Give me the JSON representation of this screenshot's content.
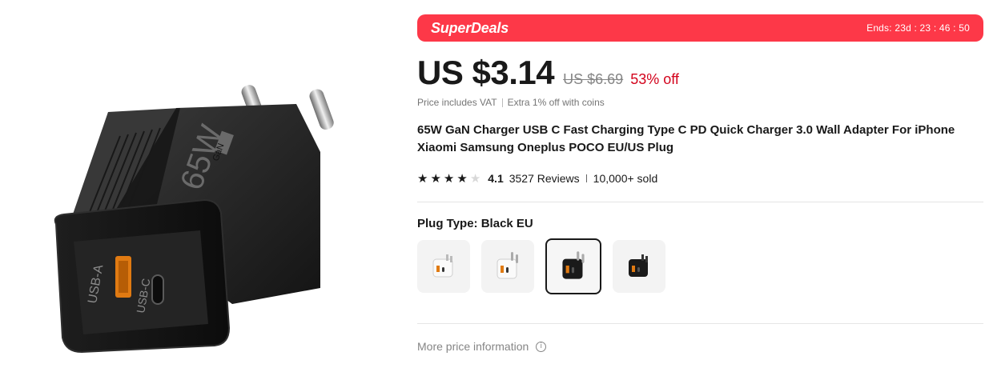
{
  "gallery": {
    "main_image_icon": "charger-product-image",
    "charger_text": {
      "wattage": "65W",
      "gan": "GaN",
      "port_a": "USB-A",
      "port_c": "USB-C"
    }
  },
  "deal": {
    "brand": "SuperDeals",
    "timer": "Ends: 23d : 23 : 46 : 50",
    "color": "#fd3848"
  },
  "price": {
    "current": "US $3.14",
    "original": "US $6.69",
    "discount": "53% off",
    "note_vat": "Price includes VAT",
    "note_coins": "Extra 1% off with coins"
  },
  "product": {
    "title": "65W GaN Charger USB C Fast Charging Type C PD Quick Charger 3.0 Wall Adapter For iPhone Xiaomi Samsung Oneplus POCO EU/US Plug"
  },
  "rating": {
    "stars_filled": 4,
    "stars_total": 5,
    "value": "4.1",
    "reviews": "3527 Reviews",
    "sold": "10,000+ sold"
  },
  "plug": {
    "label": "Plug Type: Black EU",
    "options": [
      {
        "name": "White US",
        "selected": false
      },
      {
        "name": "White EU",
        "selected": false
      },
      {
        "name": "Black EU",
        "selected": true
      },
      {
        "name": "Black US",
        "selected": false
      }
    ]
  },
  "more": {
    "label": "More price information",
    "icon": "info-icon"
  }
}
